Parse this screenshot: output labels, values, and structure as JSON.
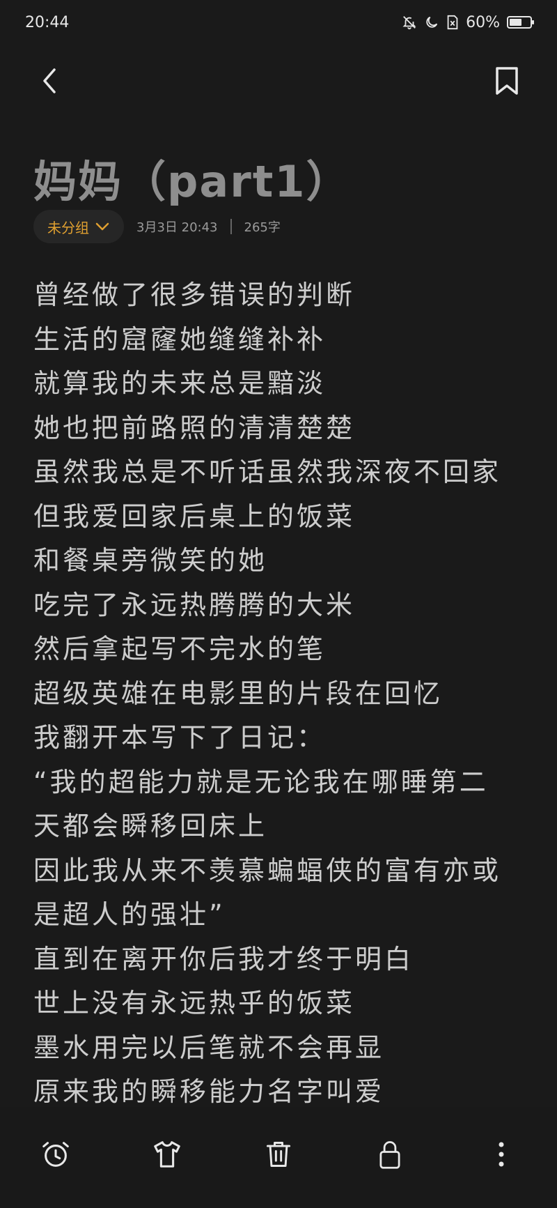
{
  "status_bar": {
    "time": "20:44",
    "battery_text": "60%",
    "battery_level": 0.6,
    "icons": [
      "bell-off-icon",
      "moon-icon",
      "sim-card-x-icon",
      "battery-icon"
    ]
  },
  "nav": {
    "back_icon": "chevron-left-icon",
    "bookmark_icon": "bookmark-icon"
  },
  "note": {
    "title": "妈妈（part1）",
    "group_label": "未分组",
    "date": "3月3日 20:43",
    "word_count": "265字",
    "lines": [
      "曾经做了很多错误的判断",
      "生活的窟窿她缝缝补补",
      "就算我的未来总是黯淡",
      "她也把前路照的清清楚楚",
      "虽然我总是不听话虽然我深夜不回家",
      "但我爱回家后桌上的饭菜",
      "和餐桌旁微笑的她",
      "吃完了永远热腾腾的大米",
      "然后拿起写不完水的笔",
      "超级英雄在电影里的片段在回忆",
      "我翻开本写下了日记：",
      "“我的超能力就是无论我在哪睡第二",
      "天都会瞬移回床上",
      "因此我从来不羡慕蝙蝠侠的富有亦或",
      "是超人的强壮”",
      "直到在离开你后我才终于明白",
      "世上没有永远热乎的饭菜",
      "墨水用完以后笔就不会再显",
      "原来我的瞬移能力名字叫爱"
    ]
  },
  "toolbar": {
    "items": [
      "alarm-clock-icon",
      "tshirt-icon",
      "trash-icon",
      "lock-icon",
      "more-vertical-icon"
    ]
  },
  "colors": {
    "background": "#1a1a1a",
    "accent": "#e0a030",
    "text": "#cdcdcd",
    "title": "#8e8e8e"
  }
}
